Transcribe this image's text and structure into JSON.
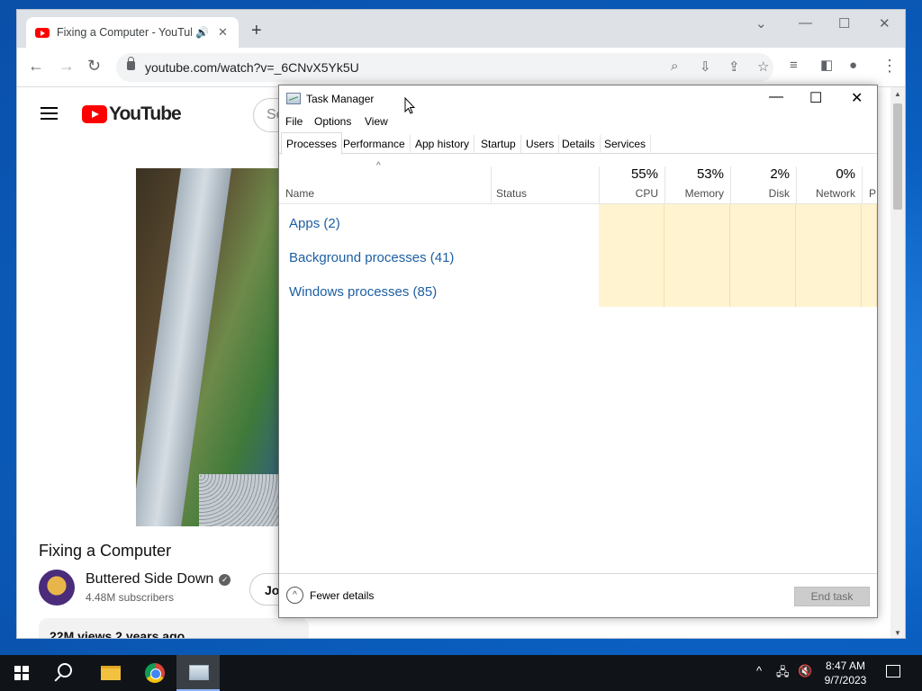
{
  "browser": {
    "tab": {
      "title": "Fixing a Computer - YouTube"
    },
    "address": {
      "url": "youtube.com/watch?v=_6CNvX5Yk5U"
    }
  },
  "youtube": {
    "logo_text": "YouTube",
    "search_placeholder": "Se",
    "video_title": "Fixing a Computer",
    "channel": {
      "name": "Buttered Side Down",
      "subscribers": "4.48M subscribers"
    },
    "join_label": "Jo",
    "stats": "22M views  2 years ago"
  },
  "task_manager": {
    "title": "Task Manager",
    "menu": [
      "File",
      "Options",
      "View"
    ],
    "tabs": [
      "Processes",
      "Performance",
      "App history",
      "Startup",
      "Users",
      "Details",
      "Services"
    ],
    "active_tab": "Processes",
    "columns": {
      "name": "Name",
      "status": "Status",
      "cpu": {
        "pct": "55%",
        "label": "CPU"
      },
      "memory": {
        "pct": "53%",
        "label": "Memory"
      },
      "disk": {
        "pct": "2%",
        "label": "Disk"
      },
      "network": {
        "pct": "0%",
        "label": "Network"
      },
      "power_partial": "P"
    },
    "groups": [
      {
        "label": "Apps (2)"
      },
      {
        "label": "Background processes (41)"
      },
      {
        "label": "Windows processes (85)"
      }
    ],
    "footer": {
      "fewer_details": "Fewer details",
      "end_task": "End task"
    }
  },
  "taskbar": {
    "time": "8:47 AM",
    "date": "9/7/2023",
    "apps": [
      "start",
      "search",
      "file-explorer",
      "chrome",
      "task-manager"
    ],
    "active_app": "task-manager"
  },
  "colors": {
    "heat_cell": "#fff4cf",
    "group_link": "#1d5fa3",
    "desktop": "#0a5fc0",
    "taskbar": "#101419"
  }
}
